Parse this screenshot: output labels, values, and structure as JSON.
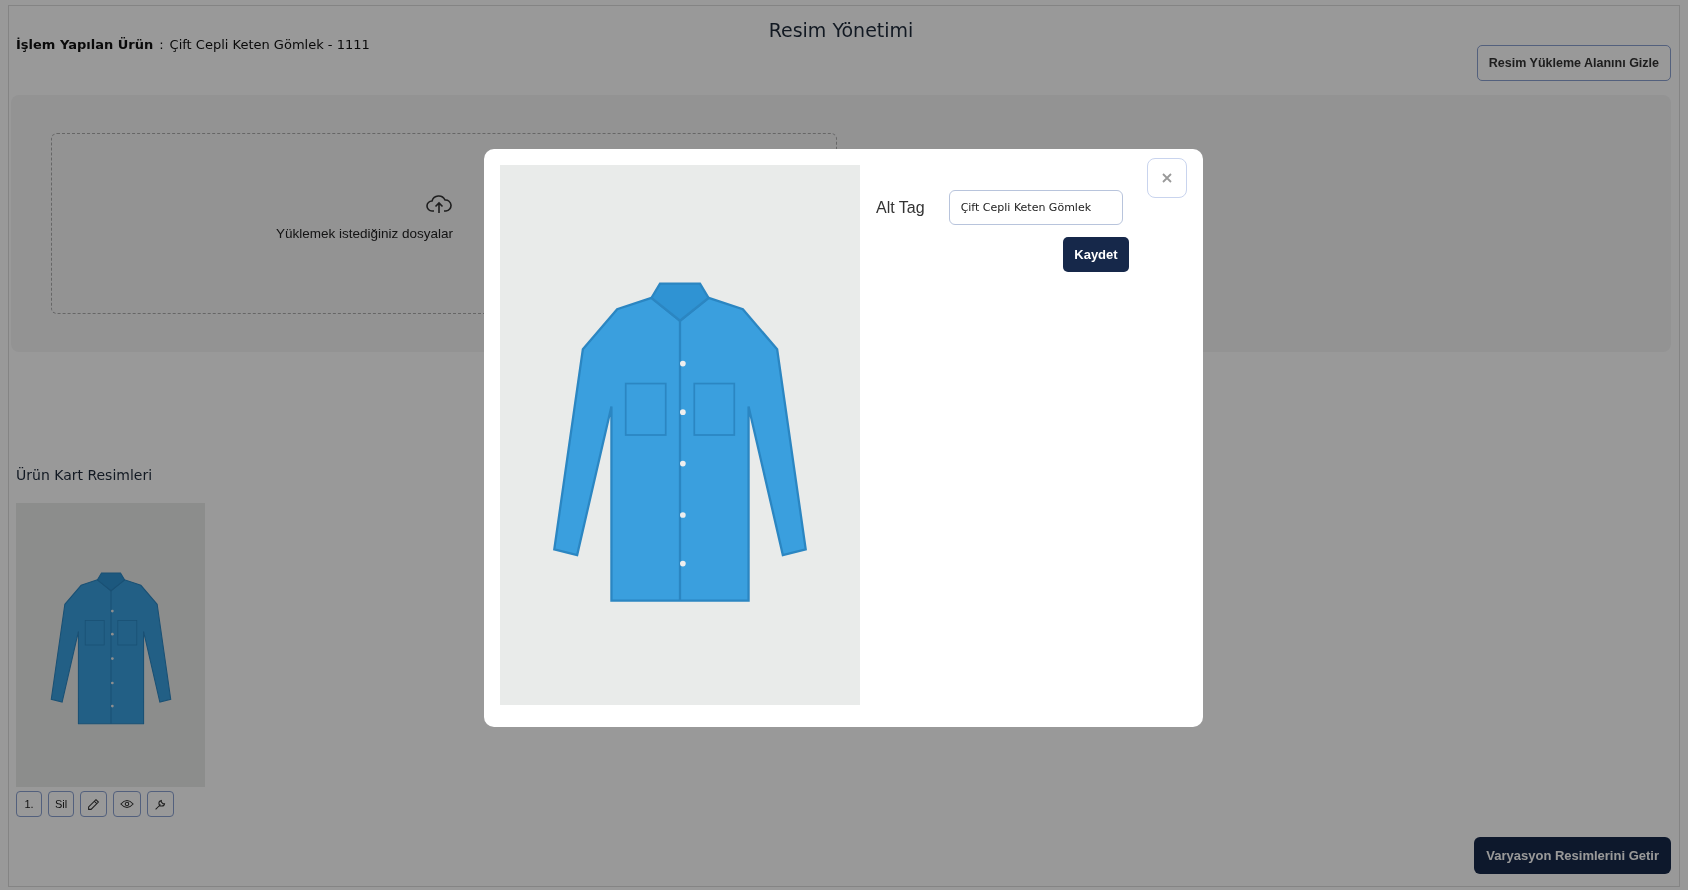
{
  "page": {
    "title": "Resim Yönetimi",
    "product_label": "İşlem Yapılan Ürün",
    "product_separator": ":",
    "product_value": "Çift Cepli Keten Gömlek - 1111",
    "toggle_button": "Resim Yükleme Alanını Gizle"
  },
  "upload": {
    "prompt": "Yüklemek istediğiniz dosyalar"
  },
  "gallery": {
    "title": "Ürün Kart Resimleri",
    "images": [
      {
        "actions": [
          {
            "kind": "text",
            "label": "1."
          },
          {
            "kind": "text",
            "label": "Sil"
          },
          {
            "kind": "edit"
          },
          {
            "kind": "view"
          },
          {
            "kind": "settings"
          }
        ]
      }
    ]
  },
  "footer_button": "Varyasyon Resimlerini Getir",
  "modal": {
    "field_label": "Alt Tag",
    "field_value": "Çift Cepli Keten Gömlek",
    "save_button": "Kaydet"
  }
}
